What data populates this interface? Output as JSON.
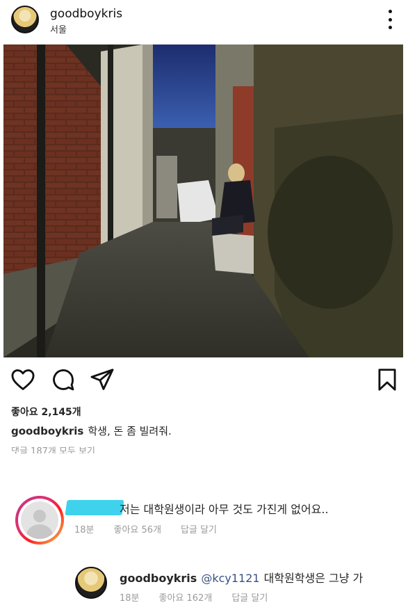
{
  "post": {
    "username": "goodboykris",
    "location": "서울",
    "likes": "좋아요 2,145개",
    "caption_user": "goodboykris",
    "caption_text": "학생, 돈 좀 빌려줘.",
    "view_comments": "댓글 187개 모두 보기"
  },
  "icons": {
    "more": "more-vertical-icon",
    "like": "heart-icon",
    "comment": "comment-icon",
    "share": "send-icon",
    "save": "bookmark-icon"
  },
  "comments": [
    {
      "text": "저는 대학원생이라 아무 것도 가진게 없어요..",
      "time": "18분",
      "likes": "좋아요 56개",
      "reply": "답글 달기"
    },
    {
      "user": "goodboykris",
      "mention": "@kcy1121",
      "text": "대학원학생은 그냥 가",
      "time": "18분",
      "likes": "좋아요 162개",
      "reply": "답글 달기"
    }
  ],
  "colors": {
    "redaction": "#3fd2ec",
    "mention": "#385185",
    "meta_gray": "#9a9a9a"
  }
}
